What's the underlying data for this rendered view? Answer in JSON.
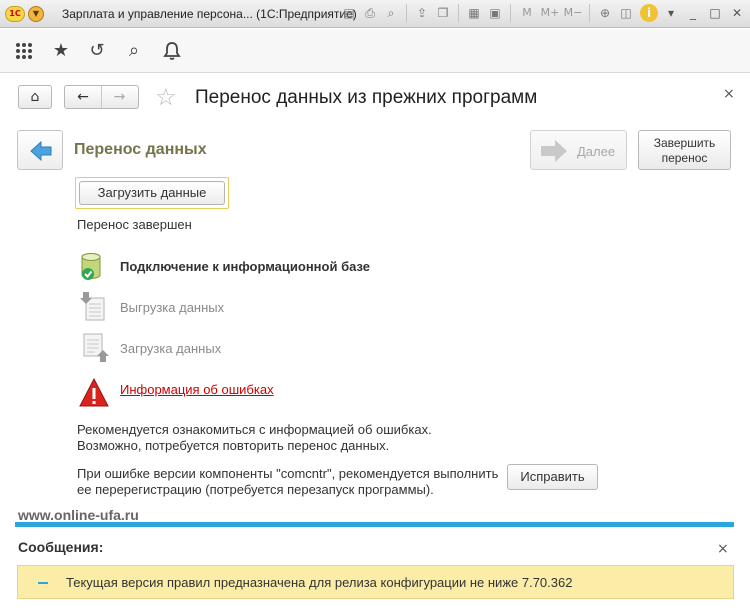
{
  "window": {
    "logo_text": "1С",
    "title": "Зарплата и управление персона...  (1С:Предприятие)",
    "toolbar_text_buttons": [
      "M",
      "M+",
      "M−"
    ]
  },
  "form": {
    "title": "Перенос данных из прежних программ"
  },
  "assistant": {
    "section_title": "Перенос данных",
    "next_label": "Далее",
    "finish_label_line1": "Завершить",
    "finish_label_line2": "перенос",
    "load_button": "Загрузить данные",
    "status": "Перенос завершен",
    "steps": [
      {
        "label": "Подключение к информационной базе",
        "state": "active"
      },
      {
        "label": "Выгрузка данных",
        "state": "inactive"
      },
      {
        "label": "Загрузка данных",
        "state": "inactive"
      }
    ],
    "error_link": "Информация об ошибках",
    "recommend_line1": "Рекомендуется ознакомиться с информацией об ошибках.",
    "recommend_line2": "Возможно, потребуется повторить перенос данных.",
    "comcntr_line1": "При ошибке версии компоненты \"comcntr\", рекомендуется выполнить",
    "comcntr_line2": "ее перерегистрацию (потребуется перезапуск программы).",
    "fix_button": "Исправить"
  },
  "watermark": "www.online-ufa.ru",
  "messages": {
    "title": "Сообщения:",
    "items": [
      {
        "text": "Текущая версия правил предназначена для релиза конфигурации не ниже 7.70.362"
      }
    ]
  },
  "colors": {
    "accent": "#2aa6de",
    "section_title": "#76744a",
    "error": "#cc0000",
    "message_bg": "#fbeda7"
  }
}
